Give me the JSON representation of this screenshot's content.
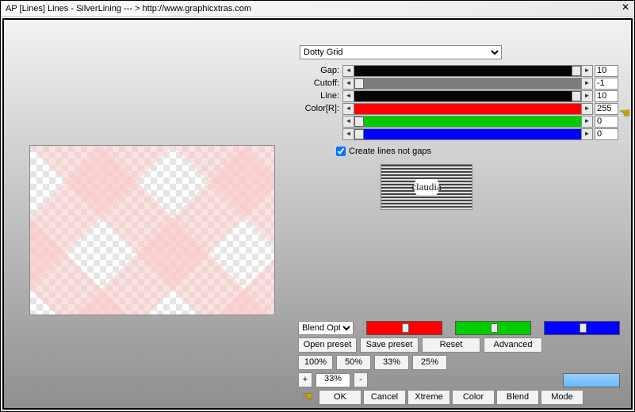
{
  "window": {
    "title": "AP [Lines]  Lines - SilverLining    --- >  http://www.graphicxtras.com"
  },
  "dropdown": {
    "selected": "Dotty Grid"
  },
  "sliders": {
    "gap": {
      "label": "Gap:",
      "value": "10",
      "color": "black"
    },
    "cutoff": {
      "label": "Cutoff:",
      "value": "-1",
      "color": "gray"
    },
    "line": {
      "label": "Line:",
      "value": "10",
      "color": "black"
    },
    "r": {
      "label": "Color[R]:",
      "value": "255",
      "color": "red"
    },
    "g": {
      "label": "",
      "value": "0",
      "color": "green"
    },
    "b": {
      "label": "",
      "value": "0",
      "color": "blue"
    }
  },
  "checkbox": {
    "label": "Create lines not gaps",
    "checked": true
  },
  "logo_text": "claudia",
  "blend_combo": "Blend Options",
  "preset_buttons": {
    "open": "Open preset",
    "save": "Save preset",
    "reset": "Reset",
    "advanced": "Advanced"
  },
  "zoom_presets": [
    "100%",
    "50%",
    "33%",
    "25%"
  ],
  "zoom": {
    "minus": "-",
    "plus": "+",
    "value": "33%"
  },
  "final_buttons": [
    "OK",
    "Cancel",
    "Xtreme",
    "Color",
    "Blend",
    "Mode"
  ],
  "arrows": {
    "left": "◄",
    "right": "►"
  },
  "close": "✕",
  "pointer": "☛"
}
